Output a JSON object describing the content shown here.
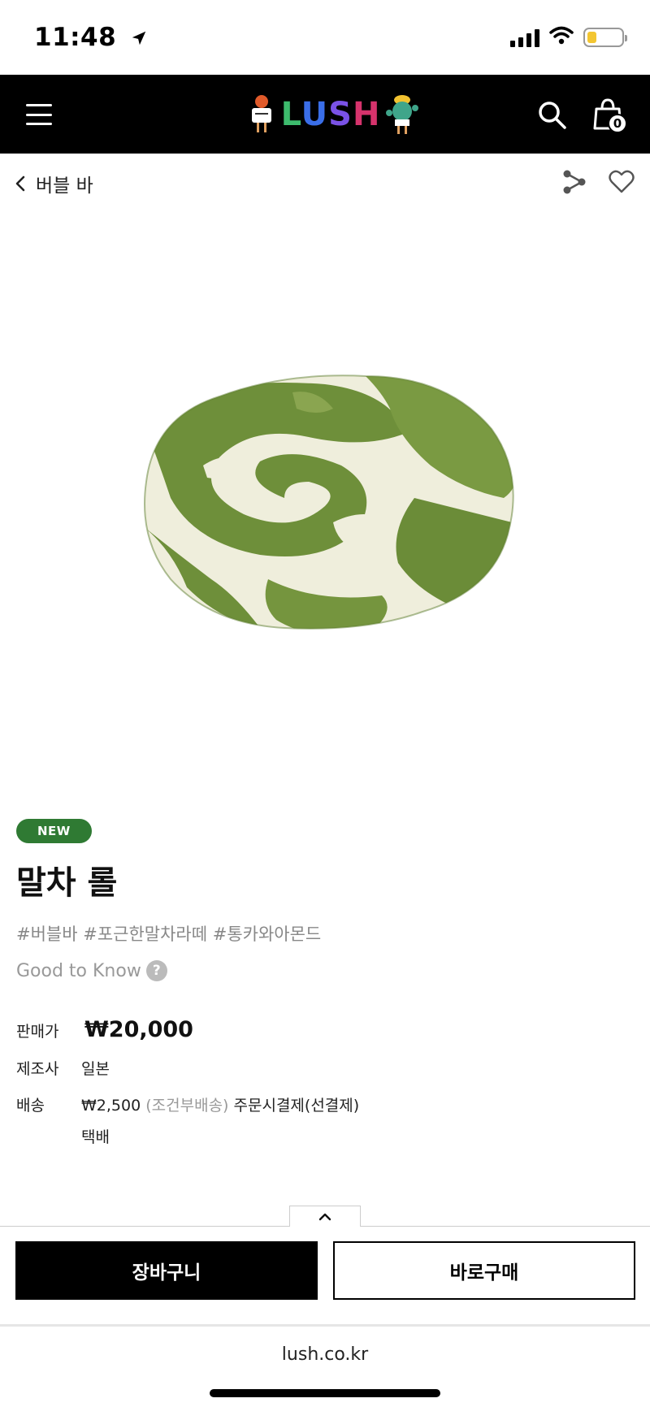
{
  "status_bar": {
    "time": "11:48"
  },
  "header": {
    "logo_text_parts": [
      "L",
      "U",
      "S",
      "H"
    ],
    "cart_count": "0",
    "icons": {
      "menu": "hamburger-menu-icon",
      "search": "search-icon",
      "cart": "shopping-bag-icon"
    }
  },
  "subnav": {
    "back_label": "버블 바"
  },
  "product": {
    "badge": "NEW",
    "title": "말차 롤",
    "hashtags": "#버블바 #포근한말차라떼 #통카와아몬드",
    "good_to_know": "Good to Know",
    "help_symbol": "?",
    "price_label": "판매가",
    "price": "₩20,000",
    "maker_label": "제조사",
    "maker": "일본",
    "shipping_label": "배송",
    "shipping_fee": "₩2,500",
    "shipping_condition": "(조건부배송)",
    "shipping_payment": "주문시결제(선결제)",
    "shipping_method": "택배",
    "image_colors": {
      "green": "#6e8f3a",
      "cream": "#efeedc"
    }
  },
  "actions": {
    "cart_label": "장바구니",
    "buy_label": "바로구매"
  },
  "browser": {
    "url": "lush.co.kr"
  },
  "colors": {
    "header_bg": "#000000",
    "badge_green": "#2f7a33"
  }
}
